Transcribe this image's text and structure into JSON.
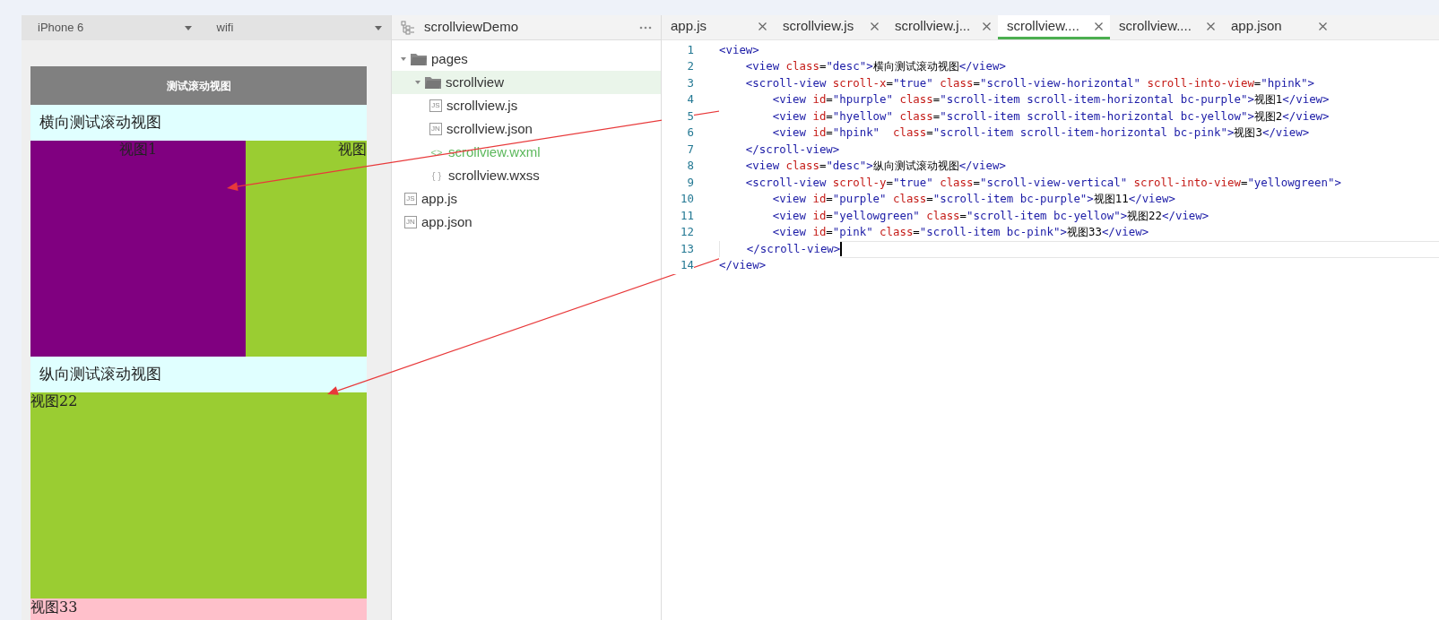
{
  "simulator": {
    "device": "iPhone 6",
    "network": "wifi",
    "nav_title": "测试滚动视图",
    "sections": [
      {
        "kind": "horizontal",
        "desc": "横向测试滚动视图",
        "items": [
          {
            "label": "视图1",
            "color": "#800080"
          },
          {
            "label": "视图",
            "color": "#9acd32"
          }
        ]
      },
      {
        "kind": "vertical",
        "desc": "纵向测试滚动视图",
        "items": [
          {
            "label": "视图22",
            "color": "#9acd32"
          },
          {
            "label": "视图33",
            "color": "#ffc0cb"
          }
        ]
      }
    ]
  },
  "project": {
    "title": "scrollviewDemo",
    "tree": [
      {
        "kind": "folder",
        "label": "pages",
        "expanded": true,
        "selected": false,
        "children": [
          {
            "kind": "folder",
            "label": "scrollview",
            "expanded": true,
            "selected": true,
            "children": [
              {
                "kind": "file",
                "glyph": "JS",
                "label": "scrollview.js",
                "selected": false,
                "active": false
              },
              {
                "kind": "file",
                "glyph": "JN",
                "label": "scrollview.json",
                "selected": false,
                "active": false
              },
              {
                "kind": "file",
                "glyph": "<>",
                "label": "scrollview.wxml",
                "selected": false,
                "active": true
              },
              {
                "kind": "file",
                "glyph": "{ }",
                "label": "scrollview.wxss",
                "selected": false,
                "active": false
              }
            ]
          }
        ]
      },
      {
        "kind": "file",
        "glyph": "JS",
        "label": "app.js",
        "selected": false,
        "active": false
      },
      {
        "kind": "file",
        "glyph": "JN",
        "label": "app.json",
        "selected": false,
        "active": false
      }
    ]
  },
  "editor": {
    "tabs": [
      {
        "label": "app.js",
        "selected": false
      },
      {
        "label": "scrollview.js",
        "selected": false
      },
      {
        "label": "scrollview.j...",
        "selected": false
      },
      {
        "label": "scrollview....",
        "selected": true
      },
      {
        "label": "scrollview....",
        "selected": false
      },
      {
        "label": "app.json",
        "selected": false
      }
    ],
    "lines": [
      {
        "number": "1",
        "current": false,
        "segments": [
          {
            "kind": "tag",
            "text": "<view>"
          }
        ]
      },
      {
        "number": "2",
        "current": false,
        "segments": [
          {
            "kind": "tag",
            "text": "    <view "
          },
          {
            "kind": "attr",
            "text": "class"
          },
          {
            "kind": "plain",
            "text": "="
          },
          {
            "kind": "value",
            "text": "\"desc\""
          },
          {
            "kind": "tag",
            "text": ">"
          },
          {
            "kind": "plain",
            "text": "横向测试滚动视图"
          },
          {
            "kind": "tag",
            "text": "</view>"
          }
        ]
      },
      {
        "number": "3",
        "current": false,
        "segments": [
          {
            "kind": "tag",
            "text": "    <scroll-view "
          },
          {
            "kind": "attr",
            "text": "scroll-x"
          },
          {
            "kind": "plain",
            "text": "="
          },
          {
            "kind": "value",
            "text": "\"true\" "
          },
          {
            "kind": "attr",
            "text": "class"
          },
          {
            "kind": "plain",
            "text": "="
          },
          {
            "kind": "value",
            "text": "\"scroll-view-horizontal\" "
          },
          {
            "kind": "attr",
            "text": "scroll-into-view"
          },
          {
            "kind": "plain",
            "text": "="
          },
          {
            "kind": "value",
            "text": "\"hpink\""
          },
          {
            "kind": "tag",
            "text": ">"
          }
        ]
      },
      {
        "number": "4",
        "current": false,
        "segments": [
          {
            "kind": "tag",
            "text": "        <view "
          },
          {
            "kind": "attr",
            "text": "id"
          },
          {
            "kind": "plain",
            "text": "="
          },
          {
            "kind": "value",
            "text": "\"hpurple\" "
          },
          {
            "kind": "attr",
            "text": "class"
          },
          {
            "kind": "plain",
            "text": "="
          },
          {
            "kind": "value",
            "text": "\"scroll-item scroll-item-horizontal bc-purple\""
          },
          {
            "kind": "tag",
            "text": ">"
          },
          {
            "kind": "plain",
            "text": "视图1"
          },
          {
            "kind": "tag",
            "text": "</view>"
          }
        ]
      },
      {
        "number": "5",
        "current": false,
        "segments": [
          {
            "kind": "tag",
            "text": "        <view "
          },
          {
            "kind": "attr",
            "text": "id"
          },
          {
            "kind": "plain",
            "text": "="
          },
          {
            "kind": "value",
            "text": "\"hyellow\" "
          },
          {
            "kind": "attr",
            "text": "class"
          },
          {
            "kind": "plain",
            "text": "="
          },
          {
            "kind": "value",
            "text": "\"scroll-item scroll-item-horizontal bc-yellow\""
          },
          {
            "kind": "tag",
            "text": ">"
          },
          {
            "kind": "plain",
            "text": "视图2"
          },
          {
            "kind": "tag",
            "text": "</view>"
          }
        ]
      },
      {
        "number": "6",
        "current": false,
        "segments": [
          {
            "kind": "tag",
            "text": "        <view "
          },
          {
            "kind": "attr",
            "text": "id"
          },
          {
            "kind": "plain",
            "text": "="
          },
          {
            "kind": "value",
            "text": "\"hpink\"  "
          },
          {
            "kind": "attr",
            "text": "class"
          },
          {
            "kind": "plain",
            "text": "="
          },
          {
            "kind": "value",
            "text": "\"scroll-item scroll-item-horizontal bc-pink\""
          },
          {
            "kind": "tag",
            "text": ">"
          },
          {
            "kind": "plain",
            "text": "视图3"
          },
          {
            "kind": "tag",
            "text": "</view>"
          }
        ]
      },
      {
        "number": "7",
        "current": false,
        "segments": [
          {
            "kind": "tag",
            "text": "    </scroll-view>"
          }
        ]
      },
      {
        "number": "8",
        "current": false,
        "segments": [
          {
            "kind": "tag",
            "text": "    <view "
          },
          {
            "kind": "attr",
            "text": "class"
          },
          {
            "kind": "plain",
            "text": "="
          },
          {
            "kind": "value",
            "text": "\"desc\""
          },
          {
            "kind": "tag",
            "text": ">"
          },
          {
            "kind": "plain",
            "text": "纵向测试滚动视图"
          },
          {
            "kind": "tag",
            "text": "</view>"
          }
        ]
      },
      {
        "number": "9",
        "current": false,
        "segments": [
          {
            "kind": "tag",
            "text": "    <scroll-view "
          },
          {
            "kind": "attr",
            "text": "scroll-y"
          },
          {
            "kind": "plain",
            "text": "="
          },
          {
            "kind": "value",
            "text": "\"true\" "
          },
          {
            "kind": "attr",
            "text": "class"
          },
          {
            "kind": "plain",
            "text": "="
          },
          {
            "kind": "value",
            "text": "\"scroll-view-vertical\" "
          },
          {
            "kind": "attr",
            "text": "scroll-into-view"
          },
          {
            "kind": "plain",
            "text": "="
          },
          {
            "kind": "value",
            "text": "\"yellowgreen\""
          },
          {
            "kind": "tag",
            "text": ">"
          }
        ]
      },
      {
        "number": "10",
        "current": false,
        "segments": [
          {
            "kind": "tag",
            "text": "        <view "
          },
          {
            "kind": "attr",
            "text": "id"
          },
          {
            "kind": "plain",
            "text": "="
          },
          {
            "kind": "value",
            "text": "\"purple\" "
          },
          {
            "kind": "attr",
            "text": "class"
          },
          {
            "kind": "plain",
            "text": "="
          },
          {
            "kind": "value",
            "text": "\"scroll-item bc-purple\""
          },
          {
            "kind": "tag",
            "text": ">"
          },
          {
            "kind": "plain",
            "text": "视图11"
          },
          {
            "kind": "tag",
            "text": "</view>"
          }
        ]
      },
      {
        "number": "11",
        "current": false,
        "segments": [
          {
            "kind": "tag",
            "text": "        <view "
          },
          {
            "kind": "attr",
            "text": "id"
          },
          {
            "kind": "plain",
            "text": "="
          },
          {
            "kind": "value",
            "text": "\"yellowgreen\" "
          },
          {
            "kind": "attr",
            "text": "class"
          },
          {
            "kind": "plain",
            "text": "="
          },
          {
            "kind": "value",
            "text": "\"scroll-item bc-yellow\""
          },
          {
            "kind": "tag",
            "text": ">"
          },
          {
            "kind": "plain",
            "text": "视图22"
          },
          {
            "kind": "tag",
            "text": "</view>"
          }
        ]
      },
      {
        "number": "12",
        "current": false,
        "segments": [
          {
            "kind": "tag",
            "text": "        <view "
          },
          {
            "kind": "attr",
            "text": "id"
          },
          {
            "kind": "plain",
            "text": "="
          },
          {
            "kind": "value",
            "text": "\"pink\" "
          },
          {
            "kind": "attr",
            "text": "class"
          },
          {
            "kind": "plain",
            "text": "="
          },
          {
            "kind": "value",
            "text": "\"scroll-item bc-pink\""
          },
          {
            "kind": "tag",
            "text": ">"
          },
          {
            "kind": "plain",
            "text": "视图33"
          },
          {
            "kind": "tag",
            "text": "</view>"
          }
        ]
      },
      {
        "number": "13",
        "current": true,
        "segments": [
          {
            "kind": "tag",
            "text": "    </scroll-view>"
          }
        ]
      },
      {
        "number": "14",
        "current": false,
        "segments": [
          {
            "kind": "tag",
            "text": "</view>"
          }
        ]
      }
    ]
  }
}
